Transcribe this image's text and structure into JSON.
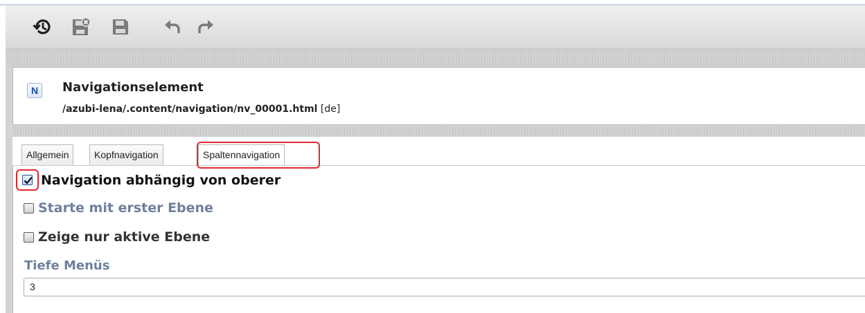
{
  "toolbar": {
    "buttons": [
      {
        "icon": "history-icon"
      },
      {
        "icon": "save-exit-icon"
      },
      {
        "icon": "save-icon"
      },
      {
        "icon": "undo-icon"
      },
      {
        "icon": "redo-icon"
      }
    ]
  },
  "resource": {
    "type_letter": "N",
    "title": "Navigationselement",
    "path": "/azubi-lena/.content/navigation/nv_00001.html",
    "locale": "[de]"
  },
  "tabs": [
    {
      "label": "Allgemein",
      "active": false
    },
    {
      "label": "Kopfnavigation",
      "active": false
    },
    {
      "label": "Spaltennavigation",
      "active": true
    }
  ],
  "options": [
    {
      "label": "Navigation abhängig von oberer",
      "checked": true
    },
    {
      "label": "Starte mit erster Ebene",
      "checked": false
    },
    {
      "label": "Zeige nur aktive Ebene",
      "checked": false
    }
  ],
  "depth_field": {
    "label": "Tiefe Menüs",
    "value": "3"
  },
  "colors": {
    "highlight": "#e4262e",
    "label_blue": "#6e7f9e"
  }
}
